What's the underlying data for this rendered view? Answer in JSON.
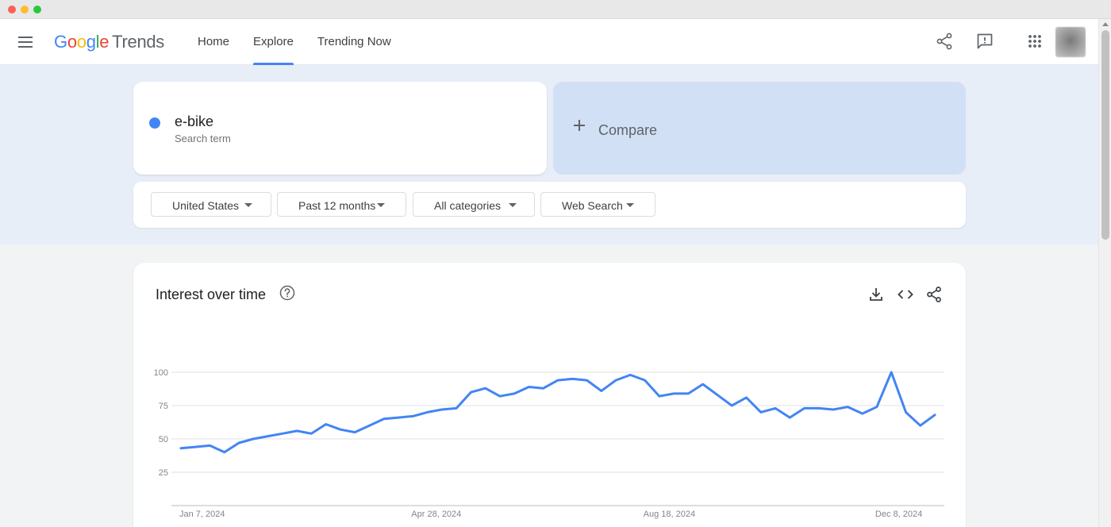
{
  "header": {
    "logo_letters": [
      {
        "char": "G",
        "color": "#4285f4"
      },
      {
        "char": "o",
        "color": "#ea4335"
      },
      {
        "char": "o",
        "color": "#fbbc05"
      },
      {
        "char": "g",
        "color": "#4285f4"
      },
      {
        "char": "l",
        "color": "#34a853"
      },
      {
        "char": "e",
        "color": "#ea4335"
      }
    ],
    "logo_suffix": "Trends",
    "nav": [
      {
        "label": "Home",
        "active": false
      },
      {
        "label": "Explore",
        "active": true
      },
      {
        "label": "Trending Now",
        "active": false
      }
    ],
    "icons": [
      "menu-icon",
      "share-icon",
      "feedback-icon",
      "apps-icon",
      "avatar"
    ]
  },
  "search": {
    "term": "e-bike",
    "term_type": "Search term",
    "term_color": "#4285f4",
    "compare_label": "Compare"
  },
  "filters": [
    {
      "label": "United States"
    },
    {
      "label": "Past 12 months"
    },
    {
      "label": "All categories"
    },
    {
      "label": "Web Search"
    }
  ],
  "chart_card": {
    "title": "Interest over time",
    "tools": [
      "download-icon",
      "embed-icon",
      "share-icon"
    ]
  },
  "chart_data": {
    "type": "line",
    "title": "Interest over time",
    "xlabel": "",
    "ylabel": "",
    "ylim": [
      0,
      100
    ],
    "yticks": [
      25,
      50,
      75,
      100
    ],
    "grid": true,
    "xtick_labels": [
      {
        "label": "Jan 7, 2024",
        "index": 0
      },
      {
        "label": "Apr 28, 2024",
        "index": 16
      },
      {
        "label": "Aug 18, 2024",
        "index": 32
      },
      {
        "label": "Dec 8, 2024",
        "index": 48
      }
    ],
    "series": [
      {
        "color": "#4285f4",
        "values": [
          43,
          44,
          45,
          40,
          47,
          50,
          52,
          54,
          56,
          54,
          61,
          57,
          55,
          60,
          65,
          66,
          67,
          70,
          72,
          73,
          85,
          88,
          82,
          84,
          89,
          88,
          94,
          95,
          94,
          86,
          94,
          98,
          94,
          82,
          84,
          84,
          91,
          83,
          75,
          81,
          70,
          73,
          66,
          73,
          73,
          72,
          74,
          69,
          74,
          100,
          70,
          60,
          68
        ]
      }
    ]
  }
}
